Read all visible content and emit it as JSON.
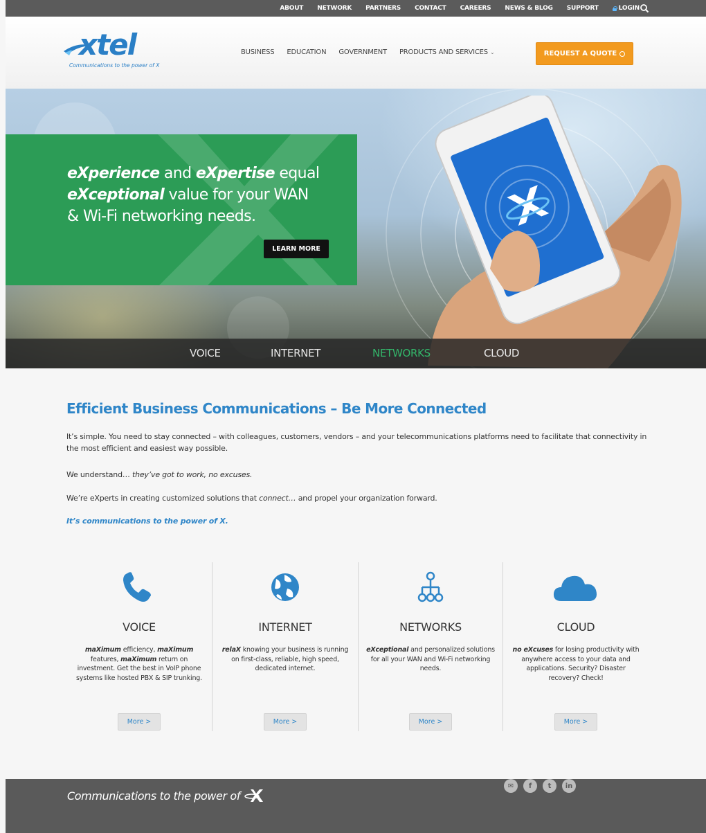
{
  "topbar": {
    "links": [
      "ABOUT",
      "NETWORK",
      "PARTNERS",
      "CONTACT",
      "CAREERS",
      "NEWS & BLOG",
      "SUPPORT"
    ],
    "login_label": "LOGIN",
    "search_icon": "search-icon"
  },
  "logo": {
    "wordmark": "xtel",
    "tagline": "Communications to the power of X"
  },
  "main_nav": {
    "items": [
      "BUSINESS",
      "EDUCATION",
      "GOVERNMENT",
      "PRODUCTS AND SERVICES"
    ],
    "quote_label": "REQUEST A QUOTE"
  },
  "hero": {
    "line1_bold": "eXperience",
    "line1_mid": " and ",
    "line1_bold2": "eXpertise",
    "line1_end": " equal",
    "line2_bold": "eXceptional",
    "line2_end": " value for your WAN",
    "line3": "& Wi-Fi networking needs.",
    "learn_more_label": "LEARN MORE",
    "tabs": [
      "VOICE",
      "INTERNET",
      "NETWORKS",
      "CLOUD"
    ],
    "active_tab": "NETWORKS"
  },
  "intro": {
    "title": "Efficient Business Communications – Be More Connected",
    "p1": "It’s simple. You need to stay connected – with colleagues, customers, vendors – and your telecommunications platforms need to facilitate that connectivity in the most efficient and easiest way possible.",
    "p2_start": "We understand… ",
    "p2_italic": "they’ve got to work, no excuses.",
    "p3_start": "We’re eXperts in creating customized solutions that ",
    "p3_italic": "connect…",
    "p3_end": " and propel your organization forward.",
    "cta": "It’s communications to the power of X."
  },
  "features": [
    {
      "title": "VOICE",
      "desc_html_parts": [
        "maXimum",
        " efficiency, ",
        "maXimum",
        " features, ",
        "maXimum",
        " return on investment. Get the best in VoIP phone systems like hosted PBX & SIP trunking."
      ],
      "more_label": "More >",
      "icon": "phone-icon"
    },
    {
      "title": "INTERNET",
      "desc_html_parts": [
        "relaX",
        " knowing your business is running on first-class, reliable, high speed, dedicated internet."
      ],
      "more_label": "More >",
      "icon": "globe-icon"
    },
    {
      "title": "NETWORKS",
      "desc_html_parts": [
        "eXceptional",
        " and personalized solutions for all your WAN and Wi-Fi networking needs."
      ],
      "more_label": "More >",
      "icon": "network-icon"
    },
    {
      "title": "CLOUD",
      "desc_html_parts": [
        "no eXcuses",
        " for losing productivity with anywhere access to your data and applications. Security? Disaster recovery? Check!"
      ],
      "more_label": "More >",
      "icon": "cloud-icon"
    }
  ],
  "footer": {
    "tagline": "Communications to the power of",
    "social": [
      "email-icon",
      "facebook-icon",
      "twitter-icon",
      "linkedin-icon"
    ]
  },
  "colors": {
    "brand_blue": "#2f86c8",
    "accent_orange": "#f29a1f",
    "hero_green": "#2c9c56",
    "active_tab_green": "#33b56a"
  }
}
